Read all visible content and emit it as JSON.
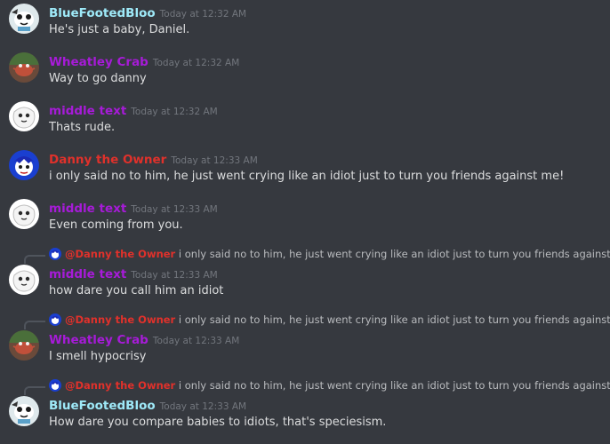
{
  "colors": {
    "background": "#36393f",
    "bluefooted": "#9ee9f8",
    "wheatley": "#a71bd8",
    "middle": "#a71bd8",
    "danny": "#e0312b",
    "timestamp": "#72767d",
    "text": "#dcddde"
  },
  "messages": [
    {
      "author": "BlueFootedBloo",
      "timestamp": "Today at 12:32 AM",
      "text": "He's just a baby, Daniel.",
      "avatar_icon": "blue-bird-avatar-icon"
    },
    {
      "author": "Wheatley Crab",
      "timestamp": "Today at 12:32 AM",
      "text": "Way to go danny",
      "avatar_icon": "crab-avatar-icon"
    },
    {
      "author": "middle text",
      "timestamp": "Today at 12:32 AM",
      "text": "Thats rude.",
      "avatar_icon": "white-creature-avatar-icon"
    },
    {
      "author": "Danny the Owner",
      "timestamp": "Today at 12:33 AM",
      "text": "i only said no to him, he just went crying like an idiot just to turn you friends against me!",
      "avatar_icon": "blue-hair-avatar-icon"
    },
    {
      "author": "middle text",
      "timestamp": "Today at 12:33 AM",
      "text": "Even coming from you.",
      "avatar_icon": "white-creature-avatar-icon"
    },
    {
      "author": "middle text",
      "timestamp": "Today at 12:33 AM",
      "text": "how dare you call him an idiot",
      "avatar_icon": "white-creature-avatar-icon",
      "reply": {
        "mention": "@Danny the Owner",
        "text": "i only said no to him, he just went crying like an idiot just to turn you friends against me!"
      }
    },
    {
      "author": "Wheatley Crab",
      "timestamp": "Today at 12:33 AM",
      "text": "I smell hypocrisy",
      "avatar_icon": "crab-avatar-icon",
      "reply": {
        "mention": "@Danny the Owner",
        "text": "i only said no to him, he just went crying like an idiot just to turn you friends against me!"
      }
    },
    {
      "author": "BlueFootedBloo",
      "timestamp": "Today at 12:33 AM",
      "text": "How dare you compare babies to idiots, that's speciesism.",
      "avatar_icon": "blue-bird-avatar-icon",
      "reply": {
        "mention": "@Danny the Owner",
        "text": "i only said no to him, he just went crying like an idiot just to turn you friends against me!"
      }
    }
  ]
}
